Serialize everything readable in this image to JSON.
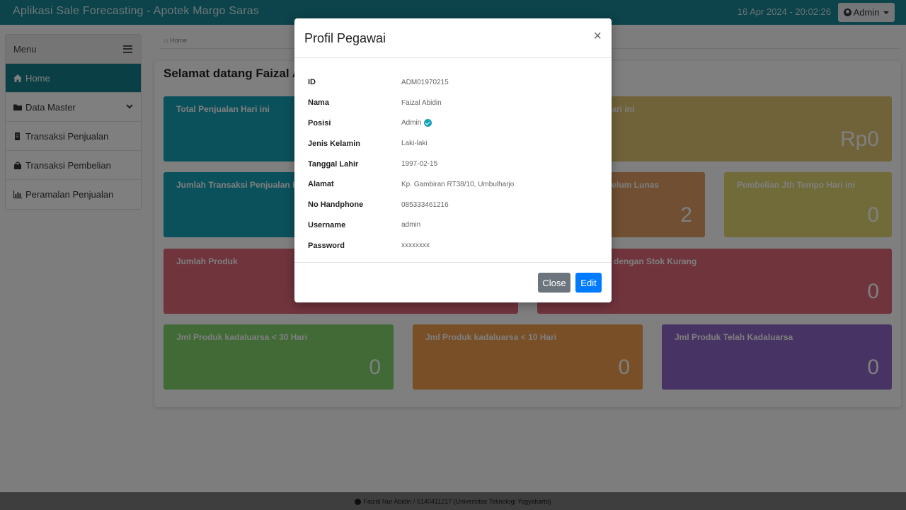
{
  "app": {
    "title": "Aplikasi Sale Forecasting - Apotek Margo Saras",
    "datetime": "16 Apr 2024 - 20:02:26",
    "user_menu": "Admin"
  },
  "sidebar": {
    "header": "Menu",
    "items": [
      {
        "label": "Home",
        "icon": "home-icon"
      },
      {
        "label": "Data Master",
        "icon": "folder-icon"
      },
      {
        "label": "Transaksi Penjualan",
        "icon": "file-icon"
      },
      {
        "label": "Transaksi Pembelian",
        "icon": "shopping-bag-icon"
      },
      {
        "label": "Peramalan Penjualan",
        "icon": "bar-chart-icon"
      }
    ]
  },
  "breadcrumb": "Home",
  "main": {
    "welcome": "Selamat datang Faizal A",
    "tiles": [
      {
        "label": "Total Penjualan Hari ini",
        "value": ""
      },
      {
        "label": "n Hari ini",
        "value": "Rp0"
      },
      {
        "label": "Jumlah Transaksi Penjualan H",
        "value": ""
      },
      {
        "label": "n Belum Lunas",
        "value": "2"
      },
      {
        "label": "Pembelian Jth Tempo Hari ini",
        "value": "0"
      },
      {
        "label": "Jumlah Produk",
        "value": ""
      },
      {
        "label": "dengan Stok Kurang",
        "value": "0"
      },
      {
        "label": "Jml Produk kadaluarsa < 30 Hari",
        "value": "0"
      },
      {
        "label": "Jml Produk kadaluarsa < 10 Hari",
        "value": "0"
      },
      {
        "label": "Jml Produk Telah Kadaluarsa",
        "value": "0"
      }
    ]
  },
  "modal": {
    "title": "Profil Pegawai",
    "close_symbol": "×",
    "rows": [
      {
        "key": "ID",
        "value": "ADM01970215"
      },
      {
        "key": "Nama",
        "value": "Faizal Abidin"
      },
      {
        "key": "Posisi",
        "value": "Admin"
      },
      {
        "key": "Jenis Kelamin",
        "value": "Laki-laki"
      },
      {
        "key": "Tanggal Lahir",
        "value": "1997-02-15"
      },
      {
        "key": "Alamat",
        "value": "Kp. Gambiran RT38/10, Umbulharjo"
      },
      {
        "key": "No Handphone",
        "value": "085333461216"
      },
      {
        "key": "Username",
        "value": "admin"
      },
      {
        "key": "Password",
        "value": "xxxxxxxx"
      }
    ],
    "close_label": "Close",
    "edit_label": "Edit"
  },
  "footer": {
    "text": "Faizal Nur Abidin / 5140411217 (Universitas Teknologi Yogyakarta)"
  },
  "colors": {
    "navbar": "#1a8796",
    "sidebar_active": "#167f8c",
    "btn_close": "#6c757d",
    "btn_edit": "#007bff"
  }
}
